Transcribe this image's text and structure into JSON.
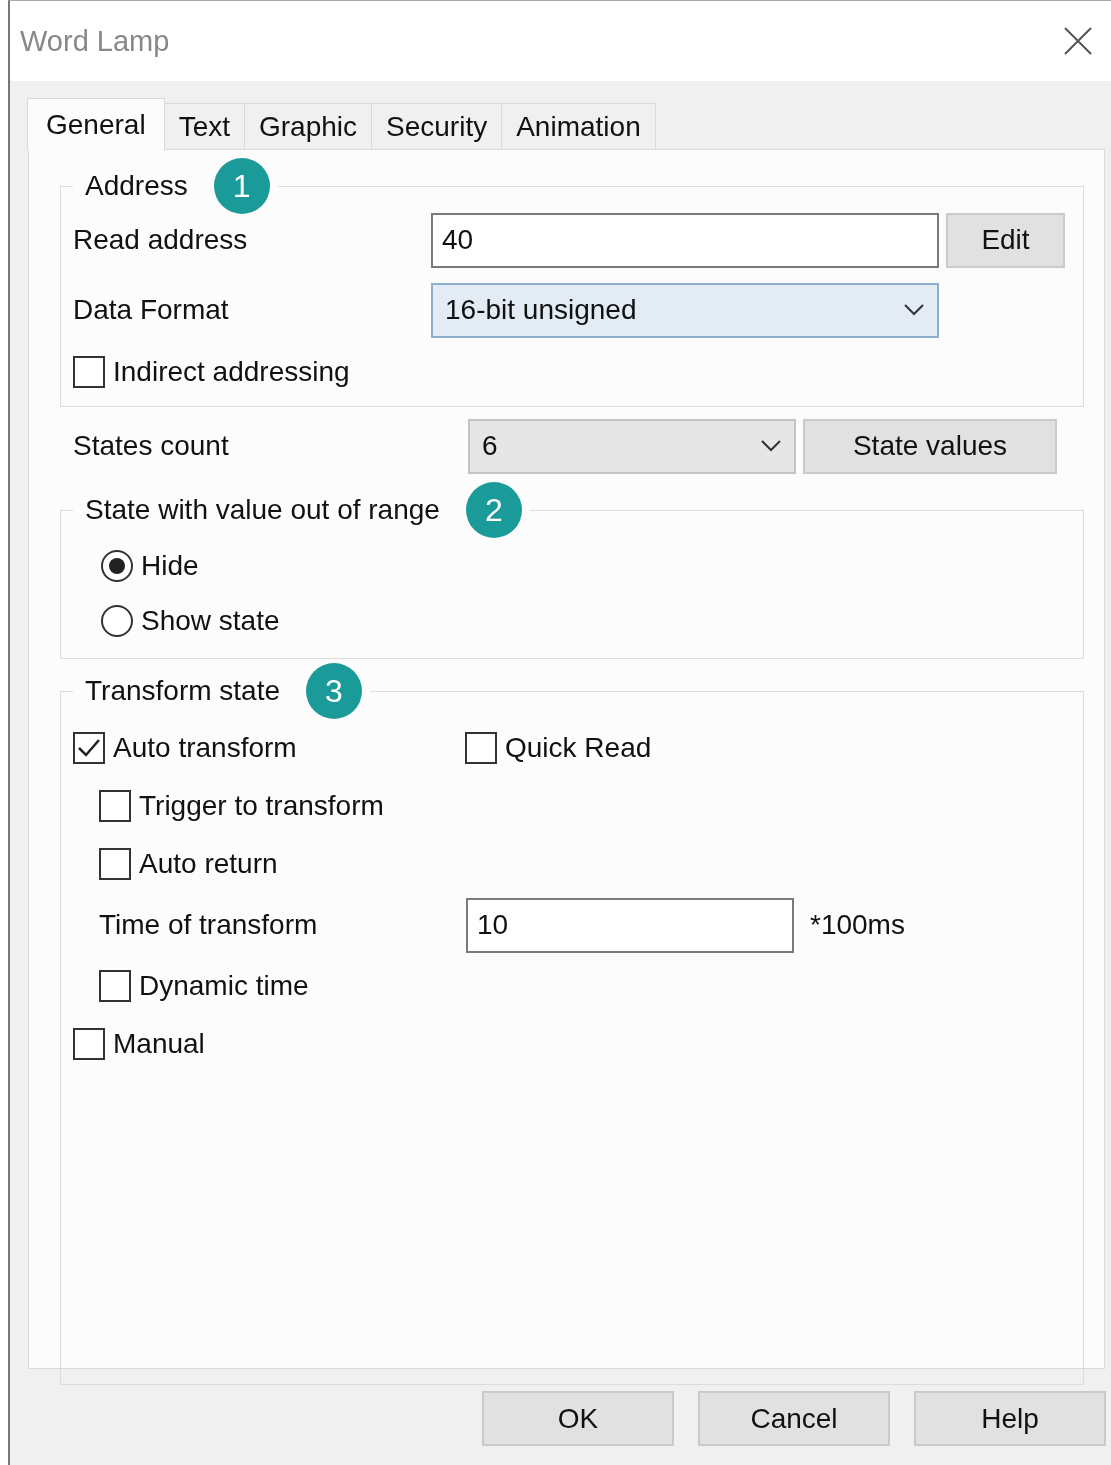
{
  "window": {
    "title": "Word Lamp"
  },
  "tabs": [
    {
      "label": "General",
      "selected": true
    },
    {
      "label": "Text",
      "selected": false
    },
    {
      "label": "Graphic",
      "selected": false
    },
    {
      "label": "Security",
      "selected": false
    },
    {
      "label": "Animation",
      "selected": false
    }
  ],
  "address": {
    "title": "Address",
    "badge": "1",
    "read_label": "Read address",
    "read_value": "40",
    "edit_button": "Edit",
    "format_label": "Data Format",
    "format_value": "16-bit unsigned",
    "indirect": {
      "label": "Indirect addressing",
      "checked": false
    }
  },
  "states_count": {
    "label": "States count",
    "value": "6",
    "button": "State values"
  },
  "out_of_range": {
    "title": "State with value out of range",
    "badge": "2",
    "options": [
      {
        "label": "Hide",
        "selected": true
      },
      {
        "label": "Show state",
        "selected": false
      }
    ]
  },
  "transform": {
    "title": "Transform state",
    "badge": "3",
    "auto_transform": {
      "label": "Auto transform",
      "checked": true
    },
    "quick_read": {
      "label": "Quick Read",
      "checked": false
    },
    "trigger": {
      "label": "Trigger to transform",
      "checked": false
    },
    "auto_return": {
      "label": "Auto return",
      "checked": false
    },
    "time_label": "Time of transform",
    "time_value": "10",
    "time_unit": "*100ms",
    "dynamic_time": {
      "label": "Dynamic time",
      "checked": false
    },
    "manual": {
      "label": "Manual",
      "checked": false
    }
  },
  "buttons": [
    "OK",
    "Cancel",
    "Help"
  ]
}
